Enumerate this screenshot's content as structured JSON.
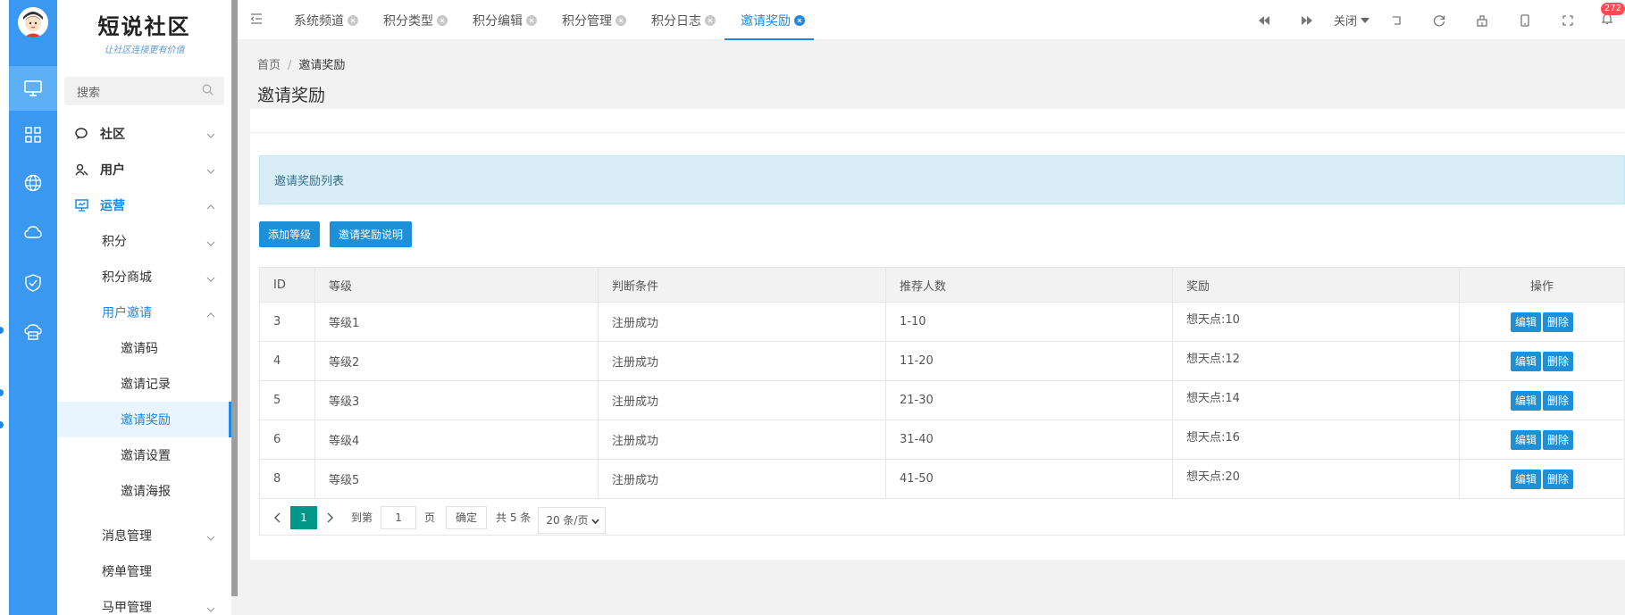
{
  "brand": {
    "title": "短说社区",
    "subtitle": "让社区连接更有价值"
  },
  "search": {
    "placeholder": "搜索"
  },
  "sidebar": {
    "groups": [
      {
        "label": "社区"
      },
      {
        "label": "用户"
      },
      {
        "label": "运营"
      }
    ],
    "items": [
      {
        "label": "积分"
      },
      {
        "label": "积分商城"
      },
      {
        "label": "用户邀请"
      }
    ],
    "invite_items": [
      {
        "label": "邀请码"
      },
      {
        "label": "邀请记录"
      },
      {
        "label": "邀请奖励"
      },
      {
        "label": "邀请设置"
      },
      {
        "label": "邀请海报"
      }
    ],
    "more_items": [
      {
        "label": "消息管理"
      },
      {
        "label": "榜单管理"
      },
      {
        "label": "马甲管理"
      }
    ]
  },
  "tabs": [
    {
      "label": "系统频道"
    },
    {
      "label": "积分类型"
    },
    {
      "label": "积分编辑"
    },
    {
      "label": "积分管理"
    },
    {
      "label": "积分日志"
    },
    {
      "label": "邀请奖励"
    }
  ],
  "toolbar": {
    "close_label": "关闭",
    "notification_count": "272"
  },
  "breadcrumb": {
    "home": "首页",
    "separator": "/",
    "current": "邀请奖励"
  },
  "page_title": "邀请奖励",
  "alert_text": "邀请奖励列表",
  "buttons": {
    "add_level": "添加等级",
    "invite_desc": "邀请奖励说明"
  },
  "table": {
    "headers": [
      "ID",
      "等级",
      "判断条件",
      "推荐人数",
      "奖励",
      "操作"
    ],
    "rows": [
      {
        "id": "3",
        "level": "等级1",
        "condition": "注册成功",
        "count": "1-10",
        "reward": "想天点:10"
      },
      {
        "id": "4",
        "level": "等级2",
        "condition": "注册成功",
        "count": "11-20",
        "reward": "想天点:12"
      },
      {
        "id": "5",
        "level": "等级3",
        "condition": "注册成功",
        "count": "21-30",
        "reward": "想天点:14"
      },
      {
        "id": "6",
        "level": "等级4",
        "condition": "注册成功",
        "count": "31-40",
        "reward": "想天点:16"
      },
      {
        "id": "8",
        "level": "等级5",
        "condition": "注册成功",
        "count": "41-50",
        "reward": "想天点:20"
      }
    ],
    "edit_label": "编辑",
    "delete_label": "删除"
  },
  "pager": {
    "current_page": "1",
    "goto_label": "到第",
    "goto_value": "1",
    "page_unit": "页",
    "confirm_label": "确定",
    "total_label": "共 5 条",
    "page_size": "20 条/页"
  },
  "colors": {
    "accent": "#1e88e5",
    "icon_bar": "#3a98f0",
    "pager_active": "#009688",
    "alert_bg": "#d9edf7"
  }
}
